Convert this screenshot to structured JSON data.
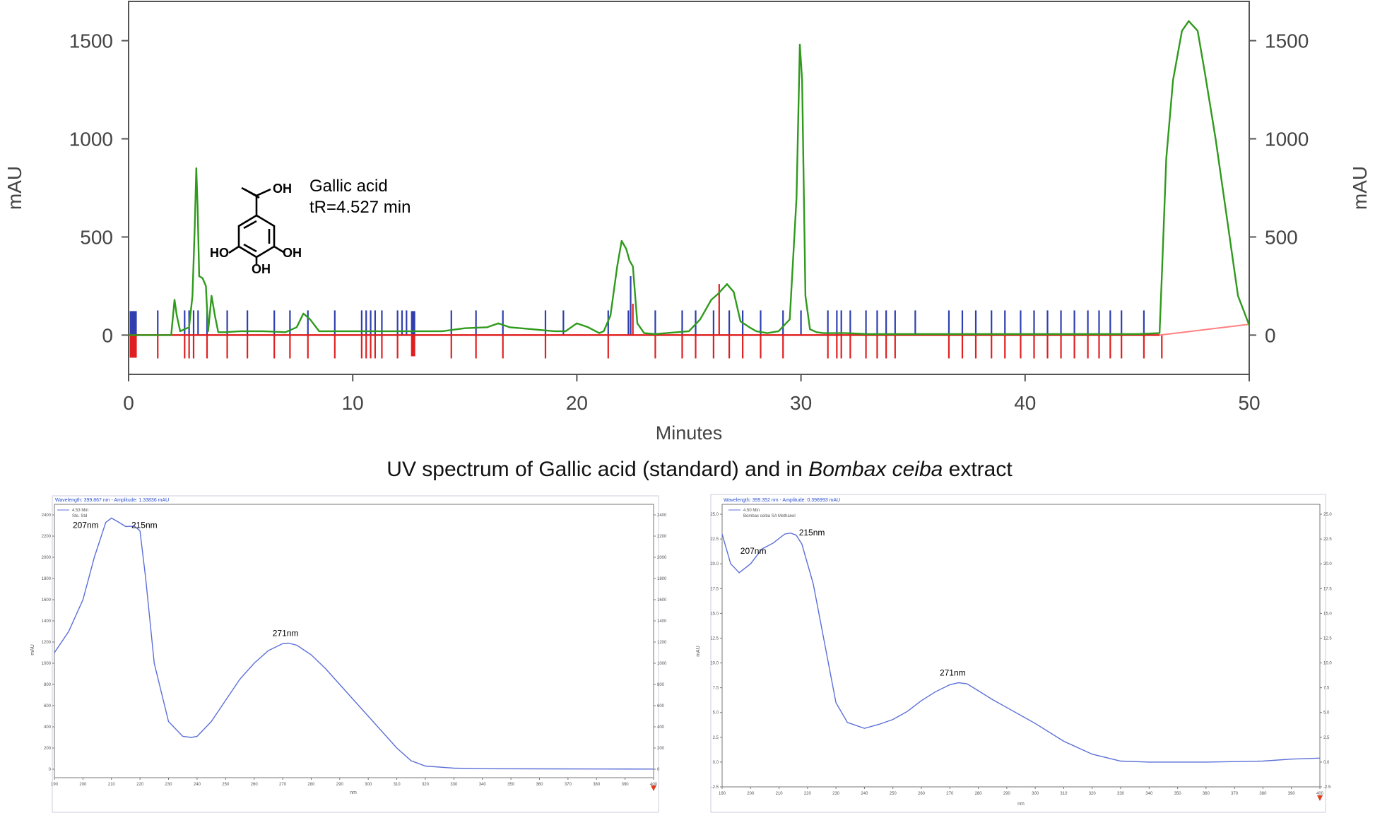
{
  "chart_data": [
    {
      "type": "line",
      "title": "",
      "xlabel": "Minutes",
      "ylabel": "mAU",
      "ylabel_right": "mAU",
      "xlim": [
        0,
        50
      ],
      "ylim": [
        -200,
        1700
      ],
      "x_ticks": [
        0,
        10,
        20,
        30,
        40,
        50
      ],
      "y_ticks": [
        0,
        500,
        1000,
        1500
      ],
      "annotation": {
        "compound": "Gallic acid",
        "retention": "tR=4.527 min"
      },
      "structure_labels": {
        "cooh": "OH",
        "oh_left": "HO",
        "oh_right": "OH",
        "oh_bottom": "OH"
      },
      "colors": {
        "trace": "#2f9a1c",
        "baseline": "#e02020",
        "peak_start": "#2f3fb0",
        "peak_end": "#e02020"
      },
      "series": [
        {
          "x": [
            0,
            1.9,
            2.05,
            2.15,
            2.3,
            2.7,
            2.85,
            2.95,
            3.02,
            3.08,
            3.15,
            3.3,
            3.45,
            3.55,
            3.7,
            3.85,
            4.0,
            4.3,
            5,
            6,
            7,
            7.5,
            7.8,
            8.1,
            8.5,
            10,
            12,
            14,
            15,
            16,
            16.5,
            17,
            18,
            19,
            19.5,
            20,
            20.5,
            21,
            21.2,
            21.5,
            21.8,
            22.0,
            22.2,
            22.35,
            22.5,
            22.7,
            23,
            23.5,
            24,
            25,
            25.5,
            26,
            26.3,
            26.7,
            27,
            27.3,
            27.7,
            28,
            28.5,
            29,
            29.5,
            29.8,
            29.95,
            30.05,
            30.2,
            30.4,
            30.7,
            31,
            32,
            33,
            35,
            40,
            45,
            46.0,
            46.1,
            46.3,
            46.6,
            47.0,
            47.3,
            47.7,
            48,
            48.5,
            49,
            49.5,
            50
          ],
          "y": [
            0,
            0,
            180,
            100,
            20,
            40,
            200,
            550,
            850,
            650,
            300,
            290,
            250,
            20,
            200,
            100,
            15,
            15,
            20,
            20,
            15,
            40,
            110,
            80,
            20,
            20,
            20,
            20,
            35,
            40,
            60,
            40,
            30,
            20,
            20,
            60,
            40,
            10,
            20,
            100,
            350,
            480,
            440,
            380,
            350,
            60,
            10,
            5,
            10,
            20,
            80,
            180,
            210,
            260,
            220,
            70,
            40,
            20,
            10,
            20,
            80,
            700,
            1480,
            1300,
            200,
            30,
            15,
            10,
            10,
            5,
            5,
            5,
            5,
            10,
            300,
            900,
            1300,
            1550,
            1600,
            1550,
            1350,
            1000,
            600,
            200,
            50
          ]
        }
      ]
    },
    {
      "type": "line",
      "title": "UV spectrum of Gallic acid (standard) and in Bombax ceiba extract",
      "title_parts": [
        "UV spectrum of Gallic acid (standard) and in ",
        "Bombax ceiba",
        " extract"
      ],
      "header": "Wavelength: 399.867 nm - Amplitude: 1.33836 mAU",
      "legend": [
        "4.53 Min",
        "Ste. Std"
      ],
      "xlabel": "nm",
      "ylabel": "mAU",
      "xlim": [
        190,
        400
      ],
      "ylim": [
        -80,
        2500
      ],
      "x_ticks": [
        190,
        200,
        210,
        220,
        230,
        240,
        250,
        260,
        270,
        280,
        290,
        300,
        310,
        320,
        330,
        340,
        350,
        360,
        370,
        380,
        390,
        400
      ],
      "y_ticks": [
        0,
        200,
        400,
        600,
        800,
        1000,
        1200,
        1400,
        1600,
        1800,
        2000,
        2200,
        2400
      ],
      "peak_labels": [
        {
          "text": "207nm",
          "x": 207,
          "y": 2370
        },
        {
          "text": "215nm",
          "x": 215,
          "y": 2290
        },
        {
          "text": "271nm",
          "x": 271,
          "y": 1190
        }
      ],
      "series": [
        {
          "name": "4.53 Min",
          "color": "#5b6fd8",
          "x": [
            190,
            195,
            200,
            204,
            208,
            210,
            212,
            215,
            218,
            220,
            222,
            225,
            230,
            235,
            238,
            240,
            245,
            250,
            255,
            260,
            265,
            270,
            272,
            275,
            280,
            285,
            290,
            300,
            310,
            315,
            320,
            330,
            340,
            360,
            380,
            400
          ],
          "y": [
            1100,
            1300,
            1600,
            2000,
            2330,
            2370,
            2340,
            2290,
            2295,
            2250,
            1800,
            1000,
            450,
            310,
            300,
            310,
            450,
            650,
            850,
            1000,
            1120,
            1185,
            1190,
            1170,
            1080,
            950,
            800,
            500,
            200,
            80,
            30,
            10,
            5,
            3,
            2,
            1
          ]
        }
      ]
    },
    {
      "type": "line",
      "title": "",
      "header": "Wavelength: 399.352 nm - Amplitude: 0.396993 mAU",
      "legend": [
        "4.50 Min",
        "Bombax ceiba SA Methanol"
      ],
      "xlabel": "nm",
      "ylabel": "mAU",
      "xlim": [
        190,
        400
      ],
      "ylim": [
        -2.5,
        26
      ],
      "x_ticks": [
        190,
        200,
        210,
        220,
        230,
        240,
        250,
        260,
        270,
        280,
        290,
        300,
        310,
        320,
        330,
        340,
        350,
        360,
        370,
        380,
        390,
        400
      ],
      "y_ticks": [
        -2.5,
        0.0,
        2.5,
        5.0,
        7.5,
        10.0,
        12.5,
        15.0,
        17.5,
        20.0,
        22.5,
        25.0
      ],
      "peak_labels": [
        {
          "text": "207nm",
          "x": 207,
          "y": 22.0
        },
        {
          "text": "215nm",
          "x": 215,
          "y": 23.0
        },
        {
          "text": "271nm",
          "x": 271,
          "y": 8.0
        }
      ],
      "series": [
        {
          "name": "4.50 Min",
          "color": "#5b6fd8",
          "x": [
            190,
            193,
            196,
            200,
            204,
            208,
            212,
            214,
            216,
            218,
            222,
            226,
            230,
            234,
            240,
            245,
            250,
            255,
            260,
            265,
            270,
            273,
            276,
            280,
            285,
            290,
            300,
            310,
            320,
            330,
            340,
            360,
            380,
            390,
            400
          ],
          "y": [
            23.0,
            20.0,
            19.1,
            20.0,
            21.5,
            22.1,
            23.0,
            23.1,
            22.9,
            22.0,
            18.0,
            12.0,
            6.0,
            4.0,
            3.4,
            3.8,
            4.3,
            5.1,
            6.2,
            7.1,
            7.8,
            8.0,
            7.9,
            7.2,
            6.3,
            5.5,
            3.9,
            2.1,
            0.8,
            0.1,
            0.0,
            0.0,
            0.1,
            0.3,
            0.4
          ]
        }
      ]
    }
  ]
}
